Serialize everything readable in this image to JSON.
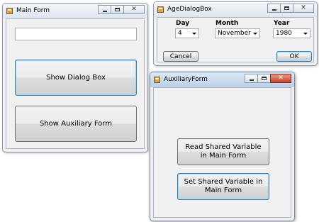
{
  "main_form": {
    "title": "Main Form",
    "textbox_value": "",
    "show_dialog_label": "Show Dialog Box",
    "show_auxiliary_label": "Show Auxiliary Form"
  },
  "age_dialog": {
    "title": "AgeDialogBox",
    "day_label": "Day",
    "day_value": "4",
    "month_label": "Month",
    "month_value": "November",
    "year_label": "Year",
    "year_value": "1980",
    "cancel_label": "Cancel",
    "ok_label": "OK"
  },
  "auxiliary_form": {
    "title": "AuxiliaryForm",
    "read_label": "Read Shared Variable in Main Form",
    "set_label": "Set Shared Variable in Main Form"
  },
  "icons": {
    "app": "form-app-icon",
    "minimize": "minimize-icon",
    "maximize": "maximize-icon",
    "close": "close-icon",
    "dropdown": "chevron-down-icon"
  },
  "colors": {
    "window_bg": "#f0f0f0",
    "focus_border": "#3c7fb1",
    "close_active": "#c6432b"
  }
}
